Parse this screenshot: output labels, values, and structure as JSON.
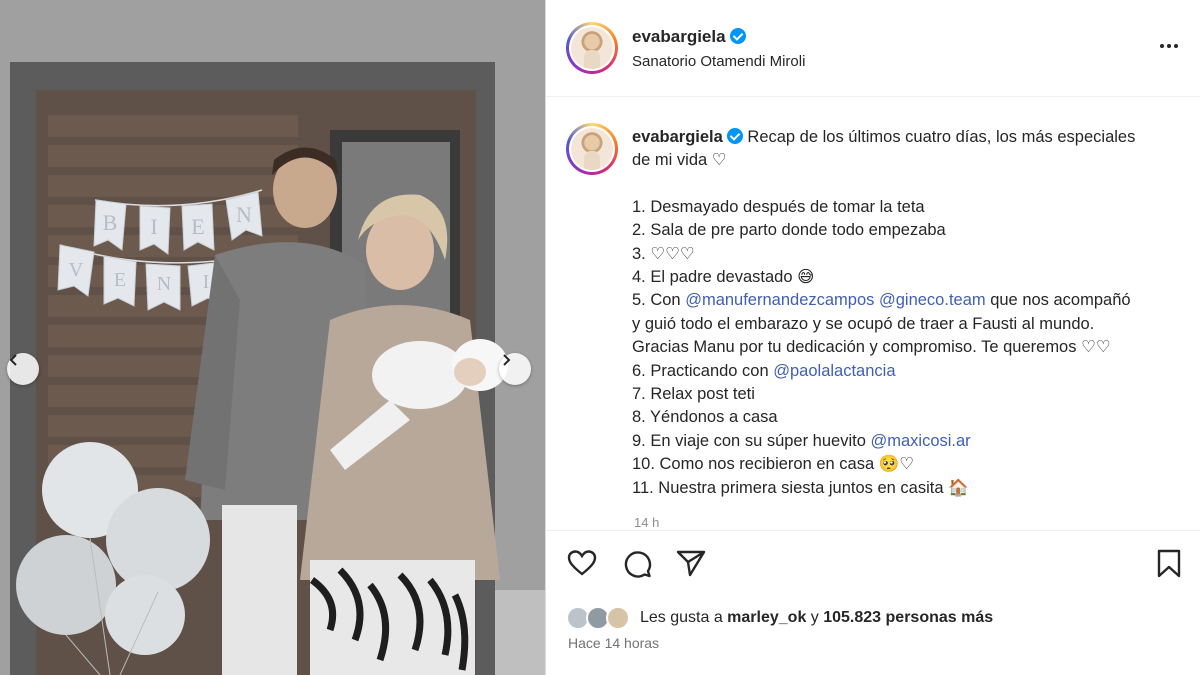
{
  "post": {
    "username": "evabargiela",
    "location": "Sanatorio Otamendi Miroli",
    "caption_intro": "Recap de los últimos cuatro días, los más especiales",
    "caption_intro_2": "de mi vida ♡",
    "list": {
      "l1": "1. Desmayado después de tomar la teta",
      "l2": "2. Sala de pre parto donde todo empezaba",
      "l3": "3. ♡♡♡",
      "l4": "4. El padre devastado 😅",
      "l5_pre": "5. Con ",
      "l5_m1": "@manufernandezcampos",
      "l5_m2": "@gineco.team",
      "l5_post": " que nos acompañó",
      "l5b": "y guió todo el embarazo y se ocupó de traer a Fausti al mundo.",
      "l5c": "Gracias Manu por tu dedicación y compromiso. Te queremos ♡♡",
      "l6_pre": "6. Practicando con ",
      "l6_m": "@paolalactancia",
      "l7": "7. Relax post teti",
      "l8": "8. Yéndonos a casa",
      "l9_pre": "9. En viaje con su súper huevito ",
      "l9_m": "@maxicosi.ar",
      "l10": "10. Como nos recibieron en casa 🥺♡",
      "l11": "11. Nuestra primera siesta juntos en casita 🏠"
    },
    "age_short": "14 h",
    "likes_prefix": "Les gusta a ",
    "likes_user": "marley_ok",
    "likes_mid": " y ",
    "likes_count": "105.823 personas más",
    "posted_ago": "Hace 14 horas"
  },
  "photo": {
    "banner_letters_top": [
      "B",
      "I",
      "E",
      "N"
    ],
    "banner_letters_bottom": [
      "V",
      "E",
      "N",
      "I"
    ]
  },
  "icons": {
    "like": "heart-icon",
    "comment": "comment-icon",
    "share": "send-icon",
    "save": "bookmark-icon",
    "more": "more-options-icon",
    "prev": "chevron-left-icon",
    "next": "chevron-right-icon"
  },
  "colors": {
    "mention": "#3f5fb5",
    "verified": "#0095f6",
    "text": "#262626",
    "muted": "#8e8e8e"
  }
}
